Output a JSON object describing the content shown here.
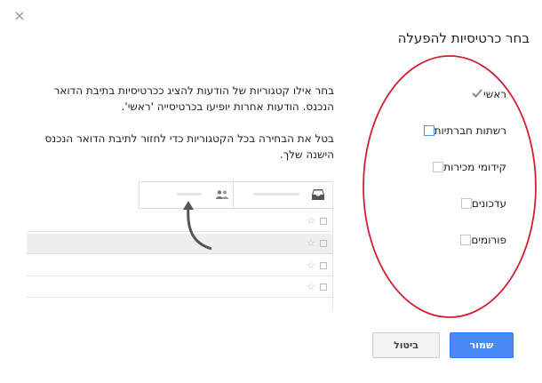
{
  "dialog": {
    "close_glyph": "×",
    "title": "בחר כרטיסיות להפעלה",
    "description_1": "בחר אילו קטגוריות של הודעות להציג ככרטיסיות בתיבת הדואר הנכנס. הודעות אחרות יופיעו בכרטיסייה 'ראשי'.",
    "description_2": "בטל את הבחירה בכל הקטגוריות כדי לחזור לתיבת הדואר הנכנס הישנה שלך."
  },
  "options": [
    {
      "label": "ראשי",
      "state": "locked-checked"
    },
    {
      "label": "רשתות חברתיות",
      "state": "unchecked-focused"
    },
    {
      "label": "קידומי מכירות",
      "state": "unchecked"
    },
    {
      "label": "עדכונים",
      "state": "unchecked"
    },
    {
      "label": "פורומים",
      "state": "unchecked"
    }
  ],
  "preview": {
    "tab_primary_icon": "inbox-icon",
    "tab_social_icon": "people-icon",
    "row_star_glyph": "☆"
  },
  "buttons": {
    "save": "שמור",
    "cancel": "ביטול"
  },
  "colors": {
    "accent": "#4a8af4",
    "annotation": "#cc2233"
  }
}
